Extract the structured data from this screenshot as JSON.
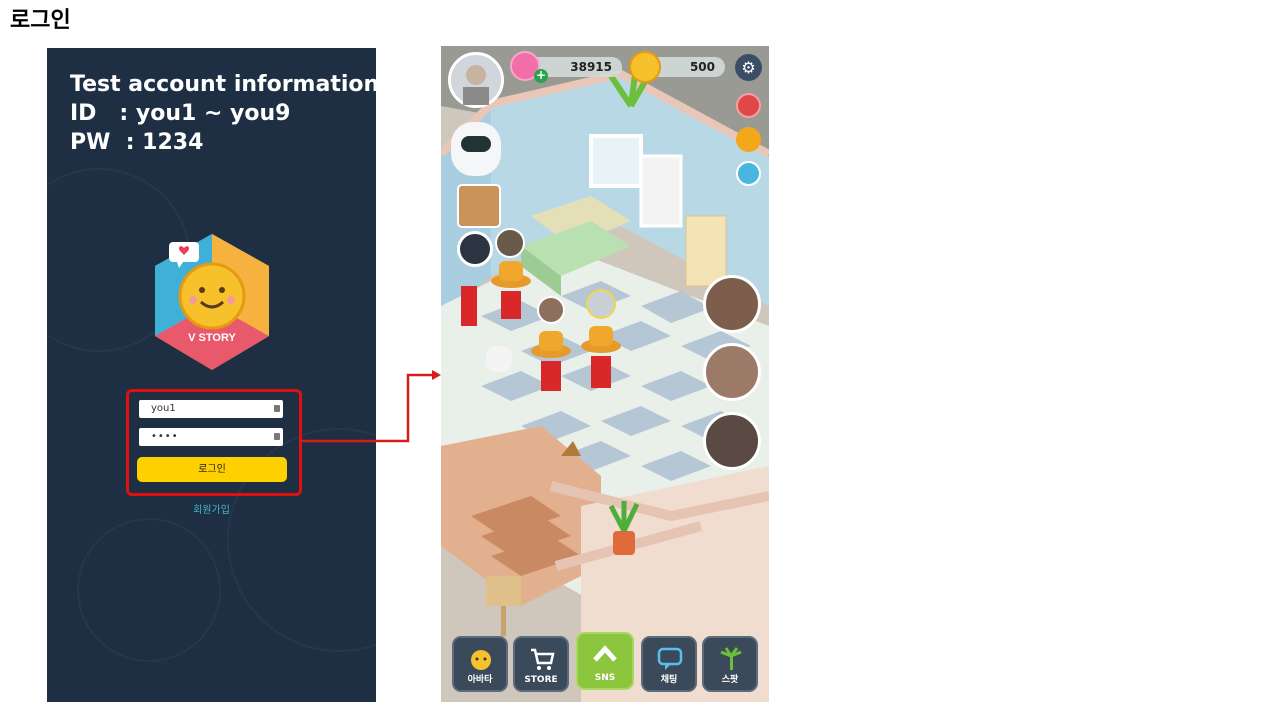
{
  "slide": {
    "title": "로그인"
  },
  "login": {
    "info_title": "Test account information",
    "info_id": "ID   : you1 ~ you9",
    "info_pw": "PW  : 1234",
    "logo_text": "V STORY",
    "id_value": "you1",
    "pw_value": "••••",
    "login_button": "로그인",
    "signup_link": "회원가입"
  },
  "game": {
    "currency_pink": "38915",
    "currency_gold": "500",
    "nav": [
      {
        "label": "아바타",
        "icon": "avatar-icon"
      },
      {
        "label": "STORE",
        "icon": "cart-icon"
      },
      {
        "label": "SNS",
        "icon": "chevron-up-icon"
      },
      {
        "label": "채팅",
        "icon": "chat-icon"
      },
      {
        "label": "스팟",
        "icon": "palm-tree-icon"
      }
    ]
  },
  "colors": {
    "login_bg": "#1e2f44",
    "login_button": "#ffd000",
    "highlight": "#e01010",
    "sns_button": "#8cc63f"
  }
}
